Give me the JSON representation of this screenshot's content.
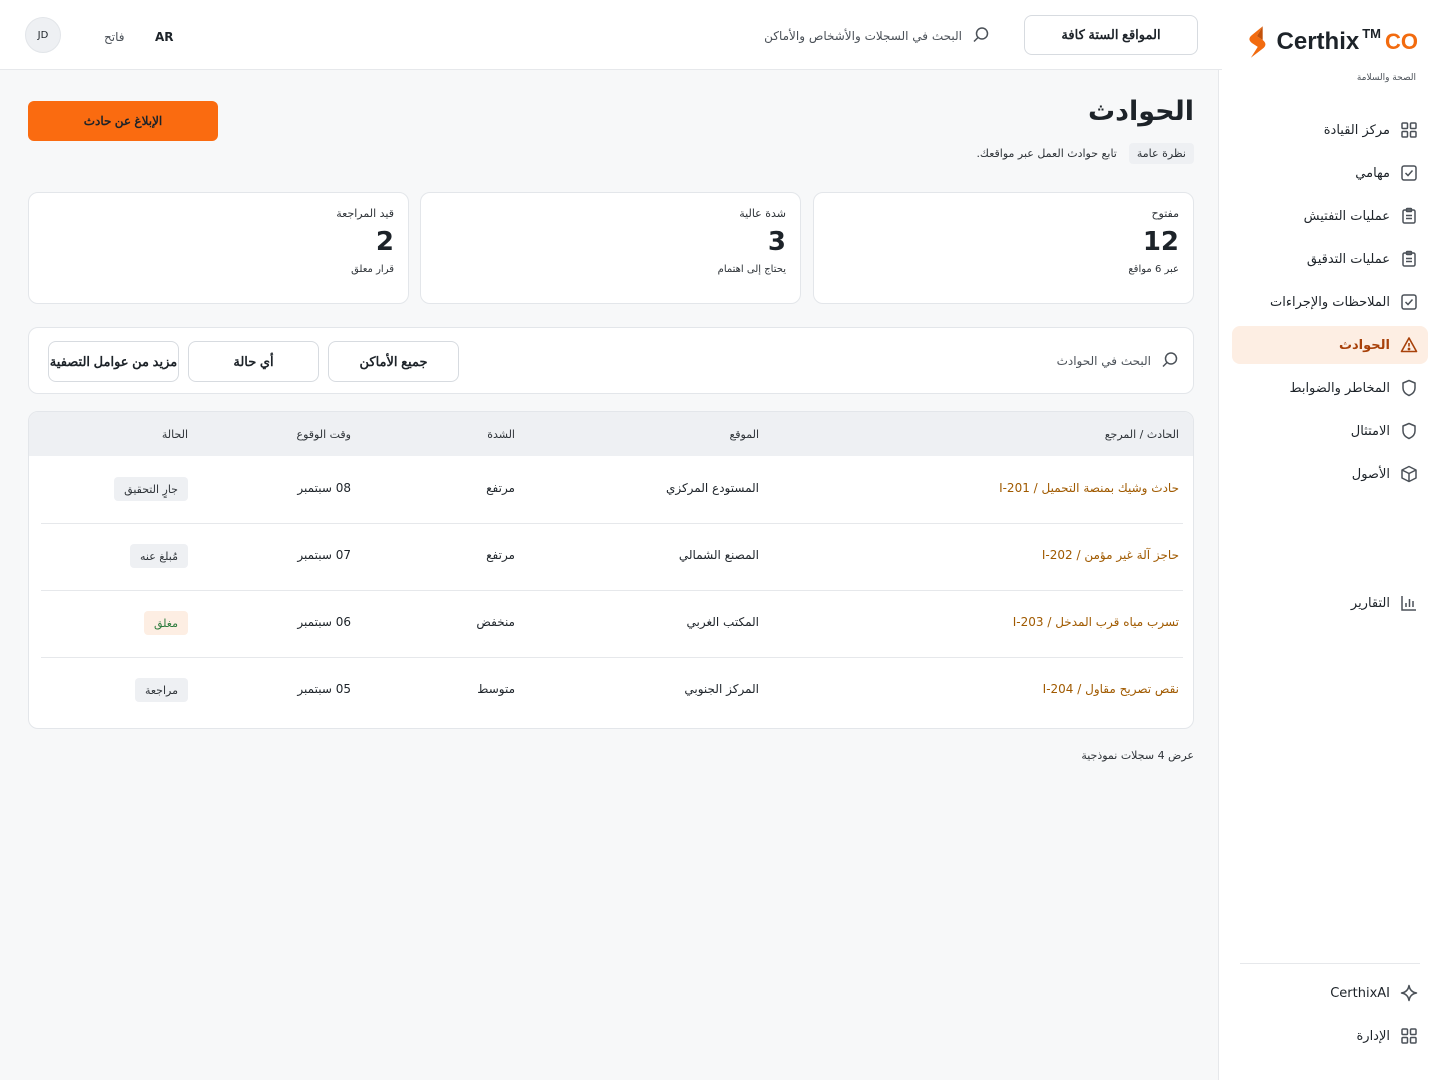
{
  "brand": {
    "name": "Certhix",
    "tm": "TM",
    "co": "CO",
    "tagline": "الصحة والسلامة",
    "accent": "#f26b0f"
  },
  "sidebar": {
    "items": [
      {
        "label": "مركز القيادة",
        "icon": "grid-icon"
      },
      {
        "label": "مهامي",
        "icon": "checkbox-icon"
      },
      {
        "label": "عمليات التفتيش",
        "icon": "clipboard-icon"
      },
      {
        "label": "عمليات التدقيق",
        "icon": "clipboard-icon"
      },
      {
        "label": "الملاحظات والإجراءات",
        "icon": "checkbox-icon"
      },
      {
        "label": "الحوادث",
        "icon": "warning-icon",
        "active": true
      },
      {
        "label": "المخاطر والضوابط",
        "icon": "shield-icon"
      },
      {
        "label": "الامتثال",
        "icon": "shield-icon"
      },
      {
        "label": "الأصول",
        "icon": "cube-icon"
      }
    ],
    "reports": {
      "label": "التقارير",
      "icon": "bar-chart-icon"
    },
    "bottom": [
      {
        "label": "CerthixAI",
        "icon": "sparkle-icon"
      },
      {
        "label": "الإدارة",
        "icon": "grid-icon"
      }
    ]
  },
  "topbar": {
    "sites_label": "المواقع الستة كافة",
    "search_placeholder": "البحث في السجلات والأشخاص والأماكن",
    "lang": "AR",
    "theme": "فاتح",
    "avatar": "JD"
  },
  "page": {
    "title": "الحوادث",
    "chip": "نظرة عامة",
    "description": "تابع حوادث العمل عبر مواقعك.",
    "report_button": "الإبلاغ عن حادث"
  },
  "stats": [
    {
      "label": "مفتوح",
      "value": "12",
      "sub": "عبر 6 مواقع"
    },
    {
      "label": "شدة عالية",
      "value": "3",
      "sub": "يحتاج إلى اهتمام"
    },
    {
      "label": "قيد المراجعة",
      "value": "2",
      "sub": "قرار معلق"
    }
  ],
  "filters": {
    "search_placeholder": "البحث في الحوادث",
    "places": "جميع الأماكن",
    "status": "أي حالة",
    "more": "مزيد من عوامل التصفية"
  },
  "table": {
    "headers": {
      "incident": "الحادث / المرجع",
      "site": "الموقع",
      "severity": "الشدة",
      "time": "وقت الوقوع",
      "status": "الحالة"
    },
    "rows": [
      {
        "incident": "حادث وشيك بمنصة التحميل / I-201",
        "site": "المستودع المركزي",
        "severity": "مرتفع",
        "time": "08 سبتمبر",
        "status": "جارٍ التحقيق",
        "status_kind": "neutral"
      },
      {
        "incident": "حاجز آلة غير مؤمن / I-202",
        "site": "المصنع الشمالي",
        "severity": "مرتفع",
        "time": "07 سبتمبر",
        "status": "مُبلغ عنه",
        "status_kind": "neutral"
      },
      {
        "incident": "تسرب مياه قرب المدخل / I-203",
        "site": "المكتب الغربي",
        "severity": "منخفض",
        "time": "06 سبتمبر",
        "status": "مغلق",
        "status_kind": "closed"
      },
      {
        "incident": "نقص تصريح مقاول / I-204",
        "site": "المركز الجنوبي",
        "severity": "متوسط",
        "time": "05 سبتمبر",
        "status": "مراجعة",
        "status_kind": "neutral"
      }
    ]
  },
  "footnote": "عرض 4 سجلات نموذجية"
}
